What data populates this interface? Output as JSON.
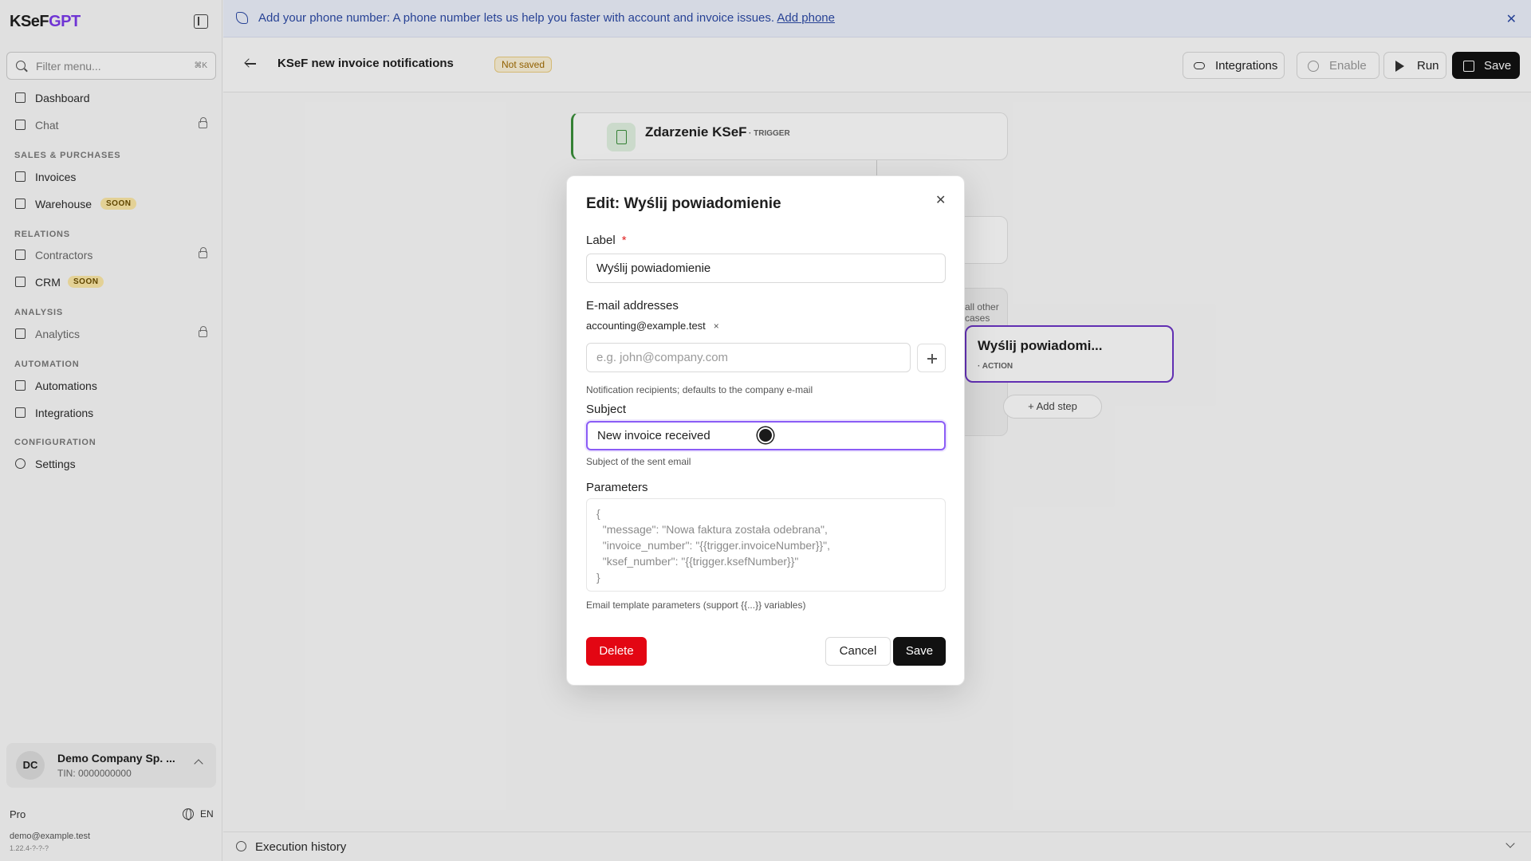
{
  "app": {
    "brand_main": "KSeF",
    "brand_accent": "GPT"
  },
  "sidebar": {
    "filter_placeholder": "Filter menu...",
    "filter_shortcut": "⌘K",
    "items": [
      {
        "label": "Dashboard"
      },
      {
        "label": "Chat"
      },
      {
        "label": "Invoices"
      },
      {
        "label": "Warehouse",
        "badge": "SOON"
      },
      {
        "label": "Contractors"
      },
      {
        "label": "CRM",
        "badge": "SOON"
      },
      {
        "label": "Analytics"
      },
      {
        "label": "Automations"
      },
      {
        "label": "Integrations"
      },
      {
        "label": "Settings"
      }
    ],
    "sections": [
      "SALES & PURCHASES",
      "RELATIONS",
      "ANALYSIS",
      "AUTOMATION",
      "CONFIGURATION"
    ],
    "company": {
      "initials": "DC",
      "name": "Demo Company Sp. ...",
      "tin": "TIN: 0000000000"
    },
    "plan": "Pro",
    "language": "EN",
    "email": "demo@example.test",
    "version": "1.22.4-?-?-?"
  },
  "banner": {
    "text": "Add your phone number: A phone number lets us help you faster with account and invoice issues.",
    "link": "Add phone",
    "close": "✕"
  },
  "header": {
    "title": "KSeF new invoice notifications",
    "status_badge": "Not saved",
    "buttons": {
      "integrations": "Integrations",
      "enable": "Enable",
      "run": "Run",
      "save": "Save"
    }
  },
  "canvas": {
    "trigger_title": "Zdarzenie KSeF",
    "trigger_tag": "· TRIGGER",
    "case_label": "all other cases",
    "action_title": "Wyślij powiadomi...",
    "action_tag": "· ACTION",
    "add_step": "+ Add step"
  },
  "modal": {
    "title": "Edit: Wyślij powiadomienie",
    "close": "✕",
    "label_label": "Label",
    "label_required": "*",
    "label_value": "Wyślij powiadomienie",
    "emails_label": "E-mail addresses",
    "email_chip": "accounting@example.test",
    "email_chip_remove": "×",
    "email_placeholder": "e.g. john@company.com",
    "email_hint": "Notification recipients; defaults to the company e-mail",
    "subject_label": "Subject",
    "subject_value": "New invoice received",
    "subject_hint": "Subject of the sent email",
    "params_label": "Parameters",
    "params_value": "{\n  \"message\": \"Nowa faktura została odebrana\",\n  \"invoice_number\": \"{{trigger.invoiceNumber}}\",\n  \"ksef_number\": \"{{trigger.ksefNumber}}\"\n}",
    "params_hint": "Email template parameters (support {{...}} variables)",
    "delete": "Delete",
    "cancel": "Cancel",
    "save": "Save"
  },
  "footer": {
    "execution_history": "Execution history"
  },
  "colors": {
    "accent": "#7c3aed",
    "focus": "#8b5cf6",
    "danger": "#e30613",
    "banner_text": "#2c4aa6"
  }
}
